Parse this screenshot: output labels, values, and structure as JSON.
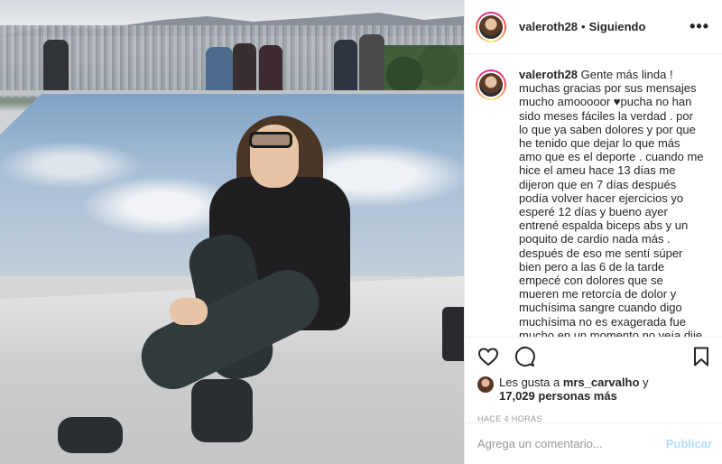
{
  "header": {
    "username": "valeroth28",
    "separator": "•",
    "follow_status": "Siguiendo",
    "more_icon": "more-options-icon"
  },
  "caption": {
    "username": "valeroth28",
    "text_before_heart": "Gente más linda ! muchas gracias por sus mensajes mucho amooooor ",
    "heart_icon": "black-heart-emoji",
    "text_after_heart": "pucha no han sido meses fáciles la verdad . por lo que ya saben dolores y por que he tenido que dejar lo que más amo que es el deporte . cuando me hice el ameu hace 13 días me dijeron que en 7 días después podía volver hacer ejercicios yo esperé 12 días y bueno ayer entrené espalda biceps abs y un poquito de cardio nada más . después de eso me sentí súper bien pero a las 6 de la tarde empecé con dolores que se mueren me retorcía de dolor y muchísima sangre cuando digo muchísima no es exagerada fue mucho en un momento no veía dije ok me desmayo . mi pololo me vino a buscar aunque"
  },
  "actions": {
    "like_icon": "heart-outline-icon",
    "comment_icon": "comment-bubble-icon",
    "save_icon": "bookmark-icon"
  },
  "likes": {
    "prefix": "Les gusta a ",
    "user": "mrs_carvalho",
    "connector": " y",
    "count": "17,029 personas más"
  },
  "timestamp": "HACE 4 HORAS",
  "comment": {
    "placeholder": "Agrega un comentario...",
    "post_label": "Publicar"
  },
  "colors": {
    "text": "#262626",
    "muted": "#999999",
    "post_button_disabled": "#b2dffc",
    "border": "#efefef"
  }
}
